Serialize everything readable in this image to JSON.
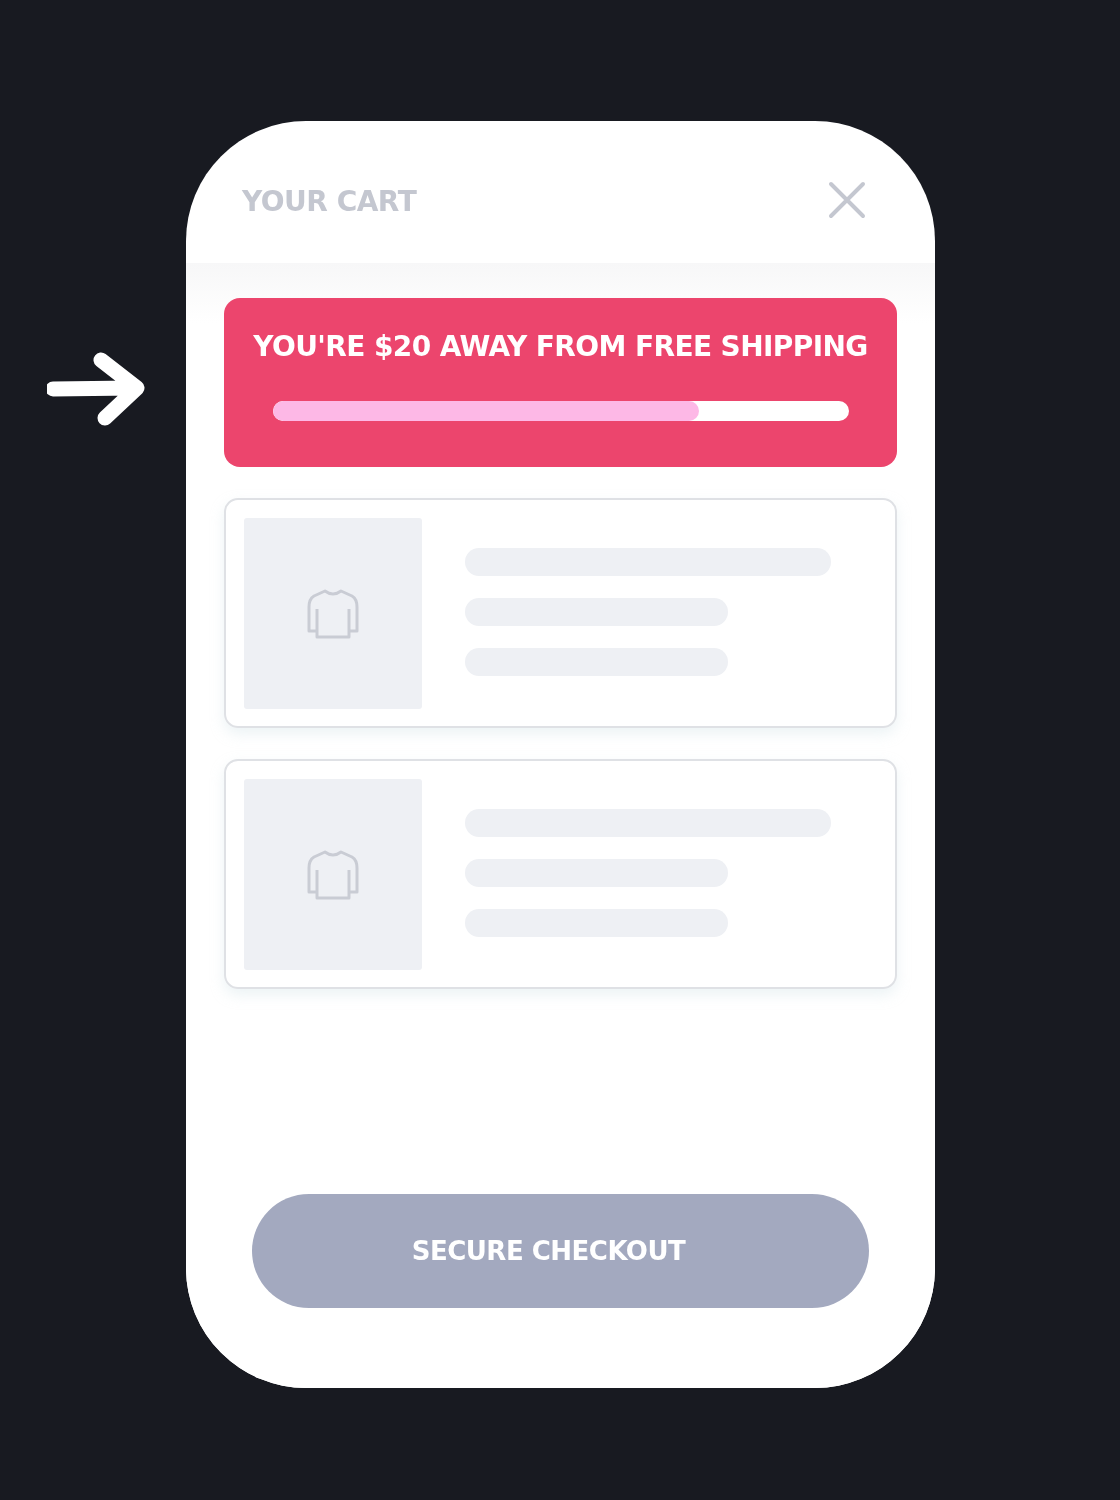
{
  "cart": {
    "title": "YOUR CART"
  },
  "shipping_banner": {
    "message": "YOU'RE $20 AWAY FROM FREE SHIPPING",
    "level": 0.74
  },
  "items": [
    {
      "kind": "skeleton"
    },
    {
      "kind": "skeleton"
    }
  ],
  "checkout_button": {
    "label": "SECURE CHECKOUT",
    "disabled": true
  }
}
